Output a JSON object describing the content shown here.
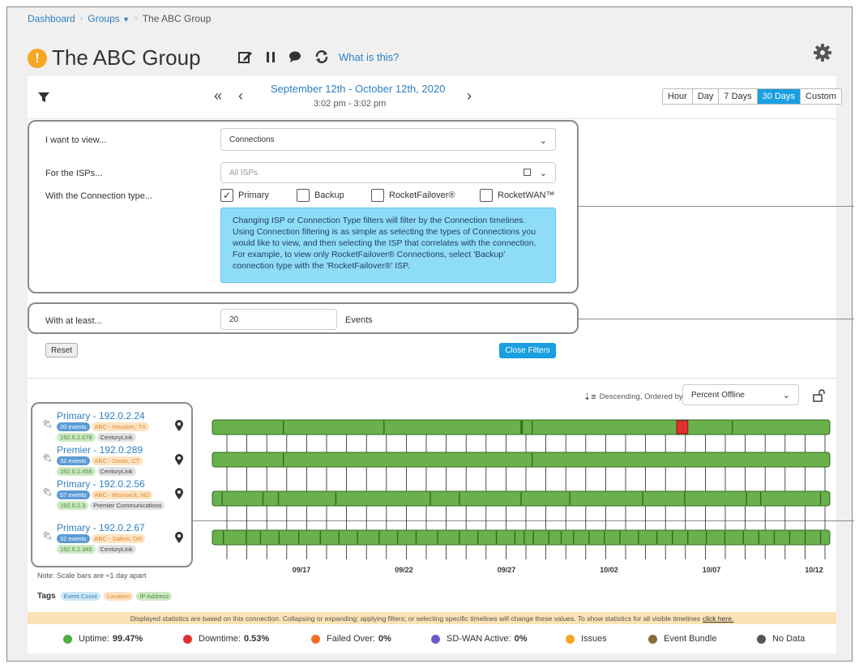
{
  "breadcrumb": {
    "dashboard": "Dashboard",
    "groups": "Groups",
    "current": "The ABC Group"
  },
  "page": {
    "title": "The ABC Group",
    "what_is_this": "What is this?"
  },
  "date_nav": {
    "range": "September 12th - October 12th, 2020",
    "time": "3:02 pm - 3:02 pm"
  },
  "range_buttons": [
    "Hour",
    "Day",
    "7 Days",
    "30 Days",
    "Custom"
  ],
  "range_active": "30 Days",
  "filters": {
    "view_label": "I want to view...",
    "view_value": "Connections",
    "isp_label": "For the ISPs...",
    "isp_placeholder": "All ISPs",
    "type_label": "With the Connection type...",
    "types": [
      {
        "label": "Primary",
        "checked": true
      },
      {
        "label": "Backup",
        "checked": false
      },
      {
        "label": "RocketFailover®",
        "checked": false
      },
      {
        "label": "RocketWAN™",
        "checked": false
      }
    ],
    "info": "Changing ISP or Connection Type filters will filter by the Connection timelines. Using Connection filtering is as simple as selecting the types of Connections you would like to view, and then selecting the ISP that correlates with the connection. For example, to view only RocketFailover® Connections, select 'Backup' connection type with the 'RocketFailover®' ISP.",
    "events_label": "With at least...",
    "events_value": "20",
    "events_unit": "Events",
    "reset": "Reset",
    "close": "Close Filters"
  },
  "sort": {
    "label": "Descending, Ordered by",
    "value": "Percent Offline"
  },
  "connections": [
    {
      "name": "Primary - 192.0.2.24",
      "events": "20 events",
      "location": "ABC - Houston, TX",
      "ip": "192.0.2.678",
      "isp": "CenturyLink"
    },
    {
      "name": "Premier - 192.0.289",
      "events": "32 events",
      "location": "ABC - Dover, CT",
      "ip": "192.0.2.456",
      "isp": "CenturyLink"
    },
    {
      "name": "Primary - 192.0.2.56",
      "events": "57 events",
      "location": "ABC - Bismarck, ND",
      "ip": "192.0.2.3",
      "isp": "Premier Communications"
    },
    {
      "name": "Primary - 192.0.2.67",
      "events": "32 events",
      "location": "ABC - Salem, OR",
      "ip": "192.0.2.345",
      "isp": "CenturyLink"
    }
  ],
  "timeline": {
    "axis_labels": [
      "09/17",
      "09/22",
      "09/27",
      "10/02",
      "10/07",
      "10/12"
    ],
    "uptime_color": "#6ab04c",
    "downtime_color": "#e03131",
    "rows": [
      {
        "ticks": [
          0.115,
          0.278,
          0.5,
          0.5,
          0.502,
          0.518,
          0.757,
          0.842
        ]
      },
      {
        "ticks": [
          0.115,
          0.518
        ]
      },
      {
        "ticks": [
          0.016,
          0.082,
          0.107,
          0.2,
          0.353,
          0.4,
          0.5,
          0.579,
          0.697,
          0.765,
          0.865,
          0.888,
          0.985
        ]
      },
      {
        "ticks": [
          0.018,
          0.055,
          0.078,
          0.108,
          0.14,
          0.175,
          0.205,
          0.235,
          0.27,
          0.3,
          0.33,
          0.365,
          0.4,
          0.43,
          0.46,
          0.49,
          0.505,
          0.52,
          0.545,
          0.565,
          0.585,
          0.61,
          0.635,
          0.66,
          0.69,
          0.72,
          0.745,
          0.77,
          0.8,
          0.83,
          0.86,
          0.885,
          0.91,
          0.935,
          0.96,
          0.985
        ]
      }
    ],
    "downtime": {
      "row": 0,
      "start": 0.752,
      "end": 0.77
    }
  },
  "note": "Note: Scale bars are ≈1 day apart",
  "tags_legend": {
    "label": "Tags",
    "items": [
      "Event Count",
      "Location",
      "IP Address"
    ]
  },
  "stat_notice": "Displayed statistics are based on this connection. Collapsing or expanding; applying filters; or selecting specific timelines will change these values. To show statistics for all visible timelines",
  "stat_link": "click here.",
  "legend": [
    {
      "label": "Uptime:",
      "value": "99.47%",
      "color": "#4caf3f"
    },
    {
      "label": "Downtime:",
      "value": "0.53%",
      "color": "#e03131"
    },
    {
      "label": "Failed Over:",
      "value": "0%",
      "color": "#f07020"
    },
    {
      "label": "SD-WAN Active:",
      "value": "0%",
      "color": "#6a5acd"
    },
    {
      "label": "Issues",
      "value": "",
      "color": "#f5a623"
    },
    {
      "label": "Event Bundle",
      "value": "",
      "color": "#8b6a3a"
    },
    {
      "label": "No Data",
      "value": "",
      "color": "#555555"
    }
  ]
}
